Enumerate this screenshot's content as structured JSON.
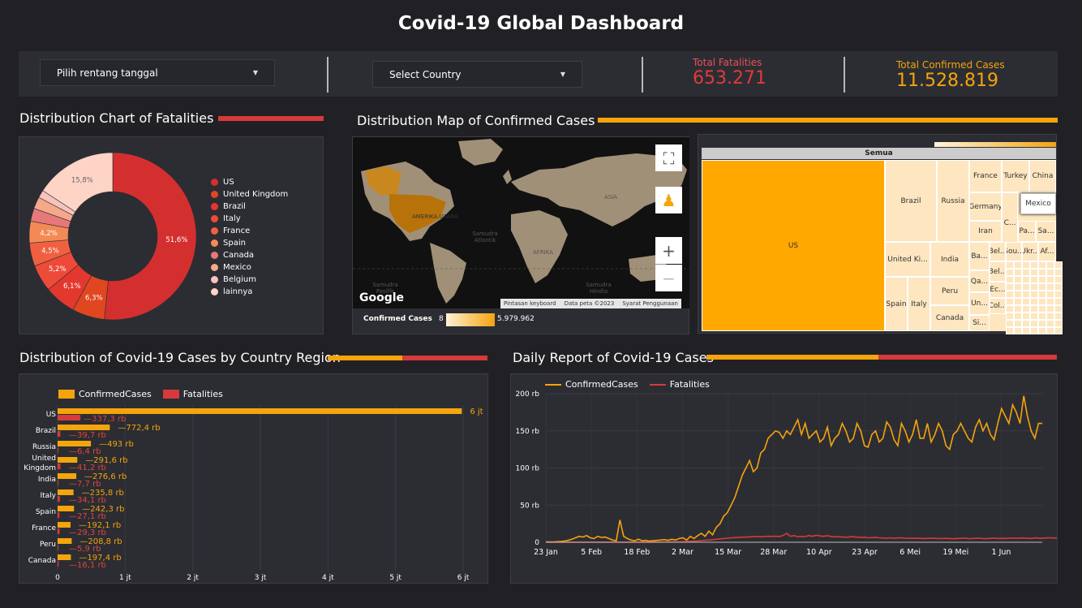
{
  "title": "Covid-19 Global Dashboard",
  "filters": {
    "date_range": "Pilih rentang tanggal",
    "country": "Select Country"
  },
  "kpis": {
    "fatalities_label": "Total Fatalities",
    "fatalities_value": "653.271",
    "confirmed_label": "Total Confirmed Cases",
    "confirmed_value": "11.528.819"
  },
  "colors": {
    "red": "#d63a3a",
    "orange": "#f4a40c",
    "panel": "#2c2d33",
    "background": "#212125"
  },
  "sections": {
    "pie_title": "Distribution Chart of Fatalities",
    "map_title": "Distribution Map of Confirmed Cases",
    "bar_title": "Distribution of Covid-19 Cases by Country Region",
    "line_title": "Daily Report of Covid-19 Cases"
  },
  "pie": {
    "chart_data": {
      "type": "pie",
      "categories": [
        "US",
        "United Kingdom",
        "Brazil",
        "Italy",
        "France",
        "Spain",
        "Canada",
        "Mexico",
        "Belgium",
        "lainnya"
      ],
      "values": [
        51.6,
        6.3,
        6.1,
        5.2,
        4.5,
        4.2,
        2.5,
        2.3,
        1.5,
        15.8
      ],
      "labels": [
        "51,6%",
        "6,3%",
        "6,1%",
        "5,2%",
        "4,5%",
        "4,2%",
        "",
        "",
        "",
        "15,8%"
      ],
      "colors": [
        "#d42f2f",
        "#e04620",
        "#e3382e",
        "#ed4a3a",
        "#f06040",
        "#f38a55",
        "#e7787a",
        "#f5a88a",
        "#f6c3bd",
        "#fdd4c6"
      ]
    }
  },
  "map": {
    "google": "Google",
    "labels": [
      "AMERIKA UTARA",
      "Samudra Atlantik",
      "ASIA",
      "AFRIKA",
      "Samudra Pasifik",
      "Samudra Hindia"
    ],
    "footer": [
      "Pintasan keyboard",
      "Data peta ©2023",
      "Syarat Penggunaan"
    ],
    "legend_label": "Confirmed Cases",
    "legend_min": "8",
    "legend_max": "5.979.962",
    "zoom_in": "+",
    "zoom_out": "−"
  },
  "treemap": {
    "header": "Semua",
    "tooltip": "Mexico",
    "cells": [
      "US",
      "Brazil",
      "Russia",
      "France",
      "Turkey",
      "China",
      "Germany",
      "Iran",
      "C...",
      "Pa...",
      "Sa...",
      "United Ki...",
      "India",
      "Ba...",
      "Bel...",
      "Sou...",
      "Ukr...",
      "Af...",
      "Qa...",
      "Bel...",
      "Peru",
      "Ec...",
      "Spain",
      "Italy",
      "Col...",
      "Canada",
      "Un...",
      "Si..."
    ]
  },
  "bar": {
    "legend": [
      "ConfirmedCases",
      "Fatalities"
    ],
    "chart_data": {
      "type": "bar",
      "orientation": "horizontal",
      "categories": [
        "US",
        "Brazil",
        "Russia",
        "United Kingdom",
        "India",
        "Italy",
        "Spain",
        "France",
        "Peru",
        "Canada"
      ],
      "category_labels": [
        [
          "US"
        ],
        [
          "Brazil"
        ],
        [
          "Russia"
        ],
        [
          "United",
          "Kingdom"
        ],
        [
          "India"
        ],
        [
          "Italy"
        ],
        [
          "Spain"
        ],
        [
          "France"
        ],
        [
          "Peru"
        ],
        [
          "Canada"
        ]
      ],
      "series": [
        {
          "name": "ConfirmedCases",
          "values": [
            5979962,
            772400,
            493000,
            291600,
            276600,
            235800,
            242300,
            192100,
            208800,
            197400
          ],
          "labels": [
            "6 jt",
            "772,4 rb",
            "493 rb",
            "291,6 rb",
            "276,6 rb",
            "235,8 rb",
            "242,3 rb",
            "192,1 rb",
            "208,8 rb",
            "197,4 rb"
          ]
        },
        {
          "name": "Fatalities",
          "values": [
            337300,
            39700,
            6400,
            41200,
            7700,
            34100,
            27100,
            29300,
            5900,
            16100
          ],
          "labels": [
            "337,3 rb",
            "39,7 rb",
            "6,4 rb",
            "41,2 rb",
            "7,7 rb",
            "34,1 rb",
            "27,1 rb",
            "29,3 rb",
            "5,9 rb",
            "16,1 rb"
          ]
        }
      ],
      "xlim": [
        0,
        6000000
      ],
      "xticks": [
        "0",
        "1 jt",
        "2 jt",
        "3 jt",
        "4 jt",
        "5 jt",
        "6 jt"
      ]
    }
  },
  "line": {
    "legend": [
      "ConfirmedCases",
      "Fatalities"
    ],
    "chart_data": {
      "type": "line",
      "x": [
        "23 Jan",
        "5 Feb",
        "18 Feb",
        "2 Mar",
        "15 Mar",
        "28 Mar",
        "10 Apr",
        "23 Apr",
        "6 Mei",
        "19 Mei",
        "1 Jun"
      ],
      "ylim": [
        0,
        200000
      ],
      "yticks": [
        "0",
        "50 rb",
        "100 rb",
        "150 rb",
        "200 rb"
      ],
      "series": [
        {
          "name": "ConfirmedCases",
          "values": [
            500,
            600,
            300,
            800,
            1000,
            1500,
            2500,
            4000,
            6000,
            8000,
            7000,
            9000,
            6000,
            5000,
            8000,
            6500,
            7000,
            5000,
            3000,
            2000,
            30000,
            8000,
            5000,
            3000,
            2000,
            4000,
            2000,
            2500,
            1500,
            2000,
            2500,
            3000,
            3500,
            2500,
            4000,
            3000,
            5000,
            6000,
            3000,
            8000,
            5000,
            9000,
            12000,
            8000,
            15000,
            10000,
            20000,
            25000,
            35000,
            40000,
            50000,
            60000,
            75000,
            90000,
            100000,
            110000,
            95000,
            100000,
            120000,
            125000,
            140000,
            145000,
            150000,
            148000,
            140000,
            150000,
            145000,
            155000,
            165000,
            145000,
            160000,
            140000,
            145000,
            150000,
            135000,
            140000,
            155000,
            130000,
            140000,
            145000,
            160000,
            150000,
            135000,
            140000,
            160000,
            150000,
            130000,
            128000,
            145000,
            150000,
            135000,
            140000,
            162000,
            155000,
            138000,
            130000,
            160000,
            150000,
            135000,
            145000,
            165000,
            140000,
            140000,
            160000,
            135000,
            145000,
            160000,
            150000,
            130000,
            125000,
            145000,
            150000,
            160000,
            150000,
            140000,
            135000,
            155000,
            165000,
            150000,
            160000,
            145000,
            138000,
            160000,
            180000,
            170000,
            160000,
            185000,
            175000,
            160000,
            197000,
            170000,
            150000,
            140000,
            160000,
            160000
          ]
        },
        {
          "name": "Fatalities",
          "values": [
            20,
            20,
            30,
            30,
            40,
            50,
            60,
            70,
            80,
            90,
            100,
            110,
            120,
            100,
            110,
            120,
            110,
            100,
            90,
            80,
            100,
            90,
            80,
            70,
            90,
            80,
            100,
            120,
            140,
            150,
            200,
            250,
            300,
            350,
            400,
            500,
            600,
            800,
            1000,
            1200,
            1500,
            1800,
            2200,
            2600,
            3000,
            3500,
            4000,
            4500,
            5000,
            5500,
            6000,
            6200,
            6500,
            6800,
            7000,
            7200,
            7500,
            7600,
            7300,
            7700,
            8000,
            7900,
            8100,
            7800,
            9000,
            12000,
            8000,
            9000,
            7500,
            7800,
            7600,
            9000,
            8000,
            9500,
            8500,
            8000,
            8800,
            7800,
            7200,
            7500,
            7000,
            6800,
            7200,
            7500,
            6800,
            6500,
            6700,
            6000,
            6200,
            6500,
            6000,
            5800,
            5500,
            6000,
            5500,
            5800,
            6000,
            5500,
            5200,
            5400,
            5600,
            5200,
            5000,
            5300,
            5600,
            5200,
            4900,
            5100,
            5300,
            5000,
            4800,
            5000,
            5200,
            5600,
            5000,
            4900,
            5300,
            5500,
            5000,
            4800,
            5200,
            5600,
            5100,
            5300,
            5000,
            5500,
            5700,
            5400,
            5600,
            5800,
            5300,
            5100,
            5900,
            5600,
            5400,
            5800,
            6000,
            5700,
            6000
          ]
        }
      ]
    }
  }
}
